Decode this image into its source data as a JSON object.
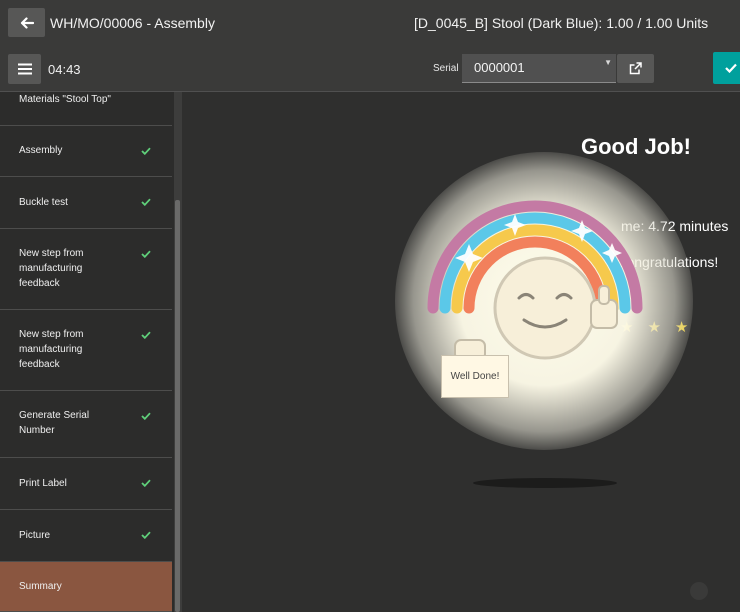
{
  "header": {
    "mo_ref": "WH/MO/00006 - Assembly",
    "product": "[D_0045_B] Stool (Dark Blue): 1.00 / 1.00 Units"
  },
  "toolbar": {
    "timer": "04:43",
    "serial_label": "Serial",
    "serial_value": "0000001"
  },
  "steps": [
    {
      "label": "Materials \"Stool Top\"",
      "done": false
    },
    {
      "label": "Assembly",
      "done": true
    },
    {
      "label": "Buckle test",
      "done": true
    },
    {
      "label": "New step from manufacturing feedback",
      "done": true
    },
    {
      "label": "New step from manufacturing feedback",
      "done": true
    },
    {
      "label": "Generate Serial Number",
      "done": true
    },
    {
      "label": "Print Label",
      "done": true
    },
    {
      "label": "Picture",
      "done": true
    },
    {
      "label": "Summary",
      "done": false,
      "active": true
    }
  ],
  "summary": {
    "title": "Good Job!",
    "time_text": "me: 4.72 minutes",
    "congrats_text": "Time. Congratulations!",
    "stars_shown": 3,
    "card_text": "Well Done!"
  },
  "colors": {
    "accent": "#00a09d",
    "active_step": "#8a5640",
    "check": "#5fcf7a",
    "star": "#f2d230"
  }
}
